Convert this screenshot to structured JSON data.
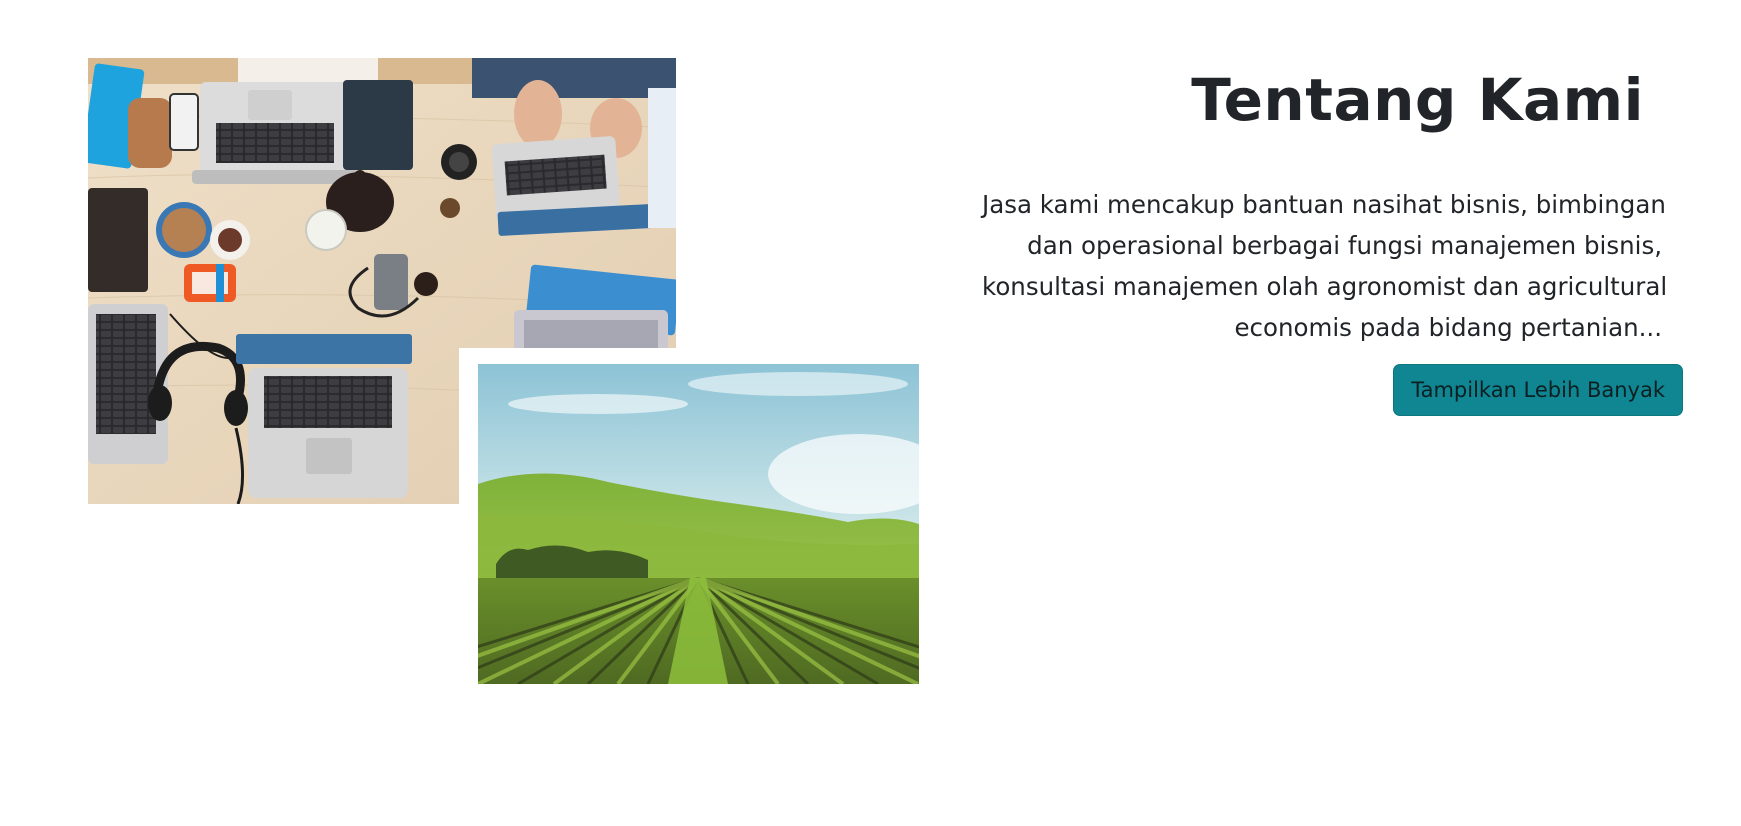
{
  "about": {
    "title": "Tentang Kami",
    "description_lines": [
      "Jasa kami mencakup bantuan nasihat bisnis, bimbingan",
      "dan operasional berbagai fungsi manajemen bisnis,",
      "konsultasi manajemen olah agronomist dan agricultural",
      "economis pada bidang pertanian..."
    ],
    "button_label": "Tampilkan Lebih Banyak"
  },
  "colors": {
    "button": "#0f8691",
    "heading": "#212529",
    "background": "#ffffff"
  },
  "images": [
    {
      "name": "office-desk-photo"
    },
    {
      "name": "farm-field-photo"
    }
  ]
}
